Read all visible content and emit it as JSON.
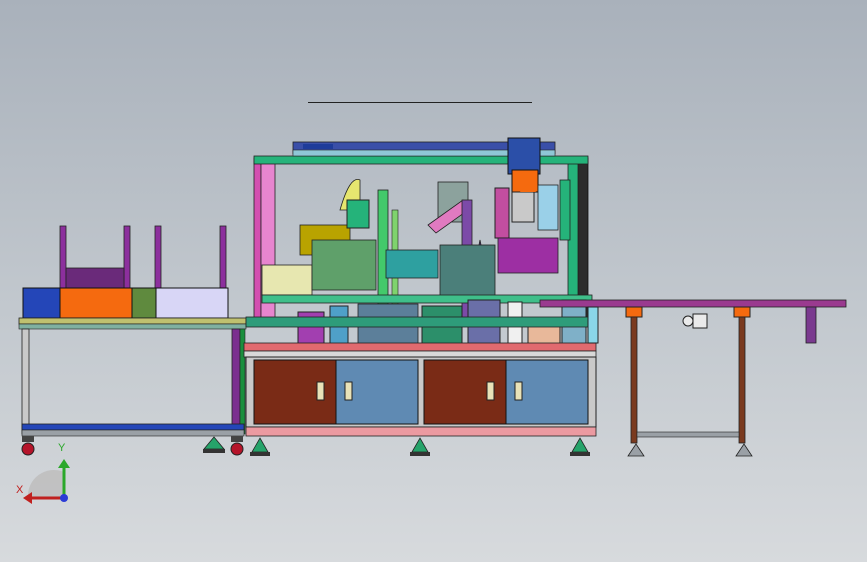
{
  "app": {
    "title": ""
  },
  "axes": {
    "x_label": "X",
    "y_label": "Y"
  },
  "colors": {
    "background_top": "#a9b1bb",
    "background_bottom": "#d7dadd",
    "frame_green": "#25b37a",
    "frame_purple": "#8c2f9d",
    "cabinet_brown": "#7a2b16",
    "cabinet_blue": "#5f8ab3",
    "tray_blue": "#2446b8",
    "tray_orange": "#f56a0f",
    "tray_lavender": "#d8d6f6",
    "conveyor_purple": "#9a3a8f"
  },
  "parts": {
    "left_table": "feeder-table",
    "main_machine": "assembly-machine",
    "right_conveyor": "output-conveyor"
  }
}
